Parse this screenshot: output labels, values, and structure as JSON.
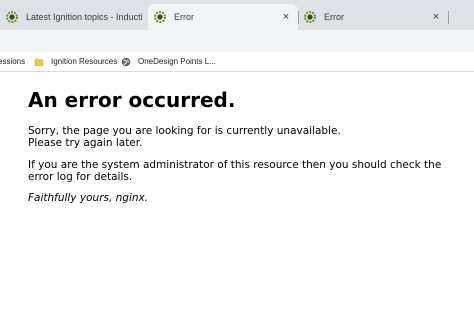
{
  "tabs": [
    {
      "title": "Latest Ignition topics - Inductive",
      "icon": "ignition-gear-icon",
      "close": "×",
      "active": false
    },
    {
      "title": "Error",
      "icon": "ignition-gear-icon",
      "close": "×",
      "active": true
    },
    {
      "title": "Error",
      "icon": "ignition-gear-icon",
      "close": "×",
      "active": false
    }
  ],
  "bookmarks": [
    {
      "label": "essions",
      "icon": null
    },
    {
      "label": "Ignition Resources",
      "icon": "folder-icon"
    },
    {
      "label": "OneDesign Points L...",
      "icon": "globe-icon"
    }
  ],
  "page": {
    "heading": "An error occurred.",
    "line1": "Sorry, the page you are looking for is currently unavailable.",
    "line2": "Please try again later.",
    "line3": "If you are the system administrator of this resource then you should check the",
    "line4": "error log for details.",
    "signature": "Faithfully yours, nginx."
  },
  "colors": {
    "tabstrip": "#dee1e6",
    "active_tab": "#f1f3f4",
    "gear_green": "#6a8f2a",
    "folder": "#f2c94c"
  }
}
